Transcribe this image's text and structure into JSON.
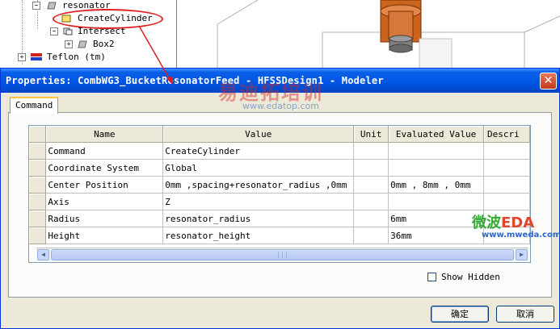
{
  "tree": {
    "items": [
      {
        "label": "resonator",
        "icon": "solid-object-icon"
      },
      {
        "label": "CreateCylinder",
        "icon": "cylinder-icon",
        "highlighted": true
      },
      {
        "label": "Intersect",
        "icon": "intersect-icon"
      },
      {
        "label": "Box2",
        "icon": "box-icon"
      },
      {
        "label": "Teflon (tm)",
        "icon": "material-icon"
      }
    ]
  },
  "dialog": {
    "title": "Properties: CombWG3_BucketResonatorFeed - HFSSDesign1 - Modeler",
    "close_icon": "close-icon",
    "tab": "Command",
    "columns": [
      "Name",
      "Value",
      "Unit",
      "Evaluated Value",
      "Descri"
    ],
    "rows": [
      {
        "name": "Command",
        "value": "CreateCylinder",
        "unit": "",
        "evaluated": ""
      },
      {
        "name": "Coordinate System",
        "value": "Global",
        "unit": "",
        "evaluated": ""
      },
      {
        "name": "Center Position",
        "value": "0mm ,spacing+resonator_radius ,0mm",
        "unit": "",
        "evaluated": "0mm , 8mm , 0mm"
      },
      {
        "name": "Axis",
        "value": "Z",
        "unit": "",
        "evaluated": ""
      },
      {
        "name": "Radius",
        "value": "resonator_radius",
        "unit": "",
        "evaluated": "6mm"
      },
      {
        "name": "Height",
        "value": "resonator_height",
        "unit": "",
        "evaluated": "36mm"
      }
    ],
    "show_hidden_label": "Show Hidden",
    "show_hidden_checked": false,
    "ok_label": "确定",
    "cancel_label": "取消"
  },
  "watermarks": {
    "site_cn": "易迪拓培训",
    "site_url": "www.edatop.com",
    "brand_cn": "微波",
    "brand_eda": "EDA",
    "brand_url": "www.mweda.com"
  },
  "colors": {
    "title_bar": "#0054e3",
    "highlight_ellipse": "#e02020",
    "close_button": "#c4391a",
    "object_orange": "#c8641e"
  }
}
